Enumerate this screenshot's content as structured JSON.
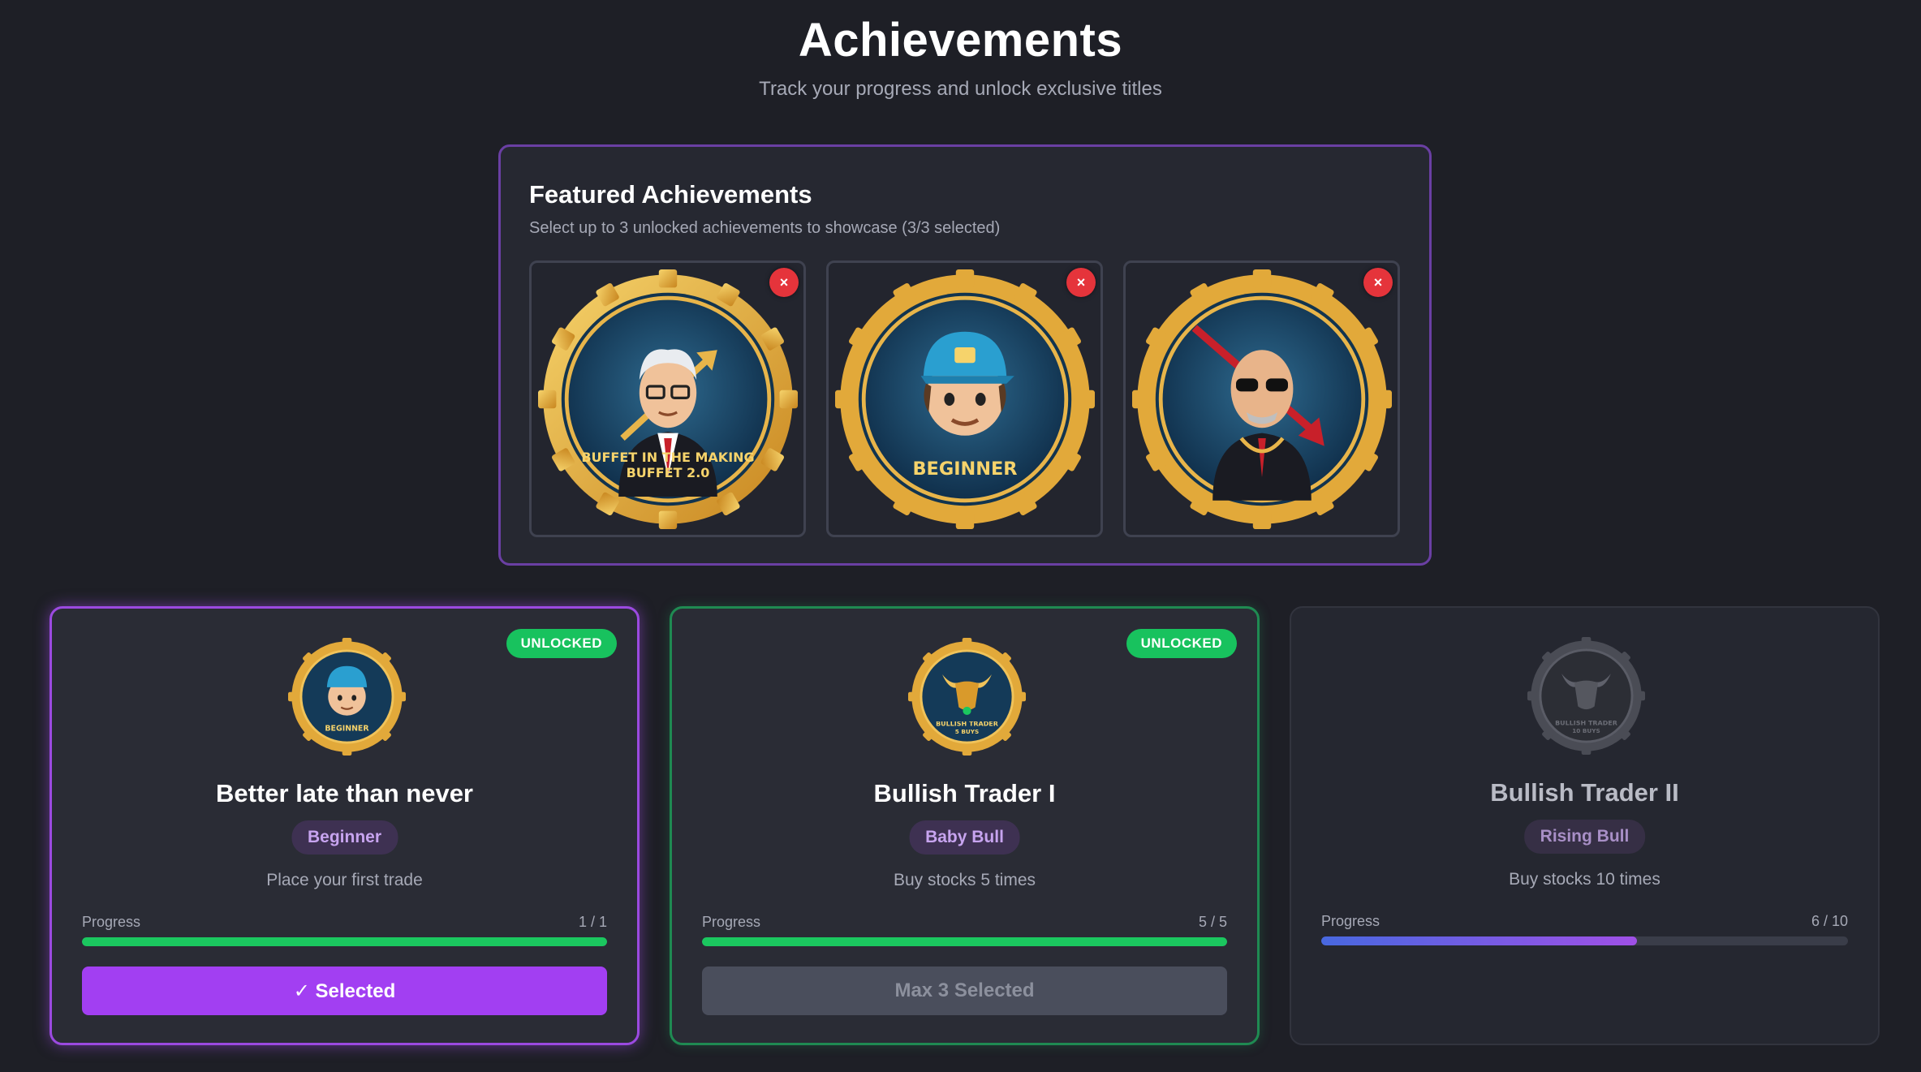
{
  "header": {
    "title": "Achievements",
    "subtitle": "Track your progress and unlock exclusive titles"
  },
  "featured": {
    "title": "Featured Achievements",
    "subtitle": "Select up to 3 unlocked achievements to showcase (3/3 selected)",
    "remove_label": "×",
    "slots": [
      {
        "medal_text_1": "BUFFET IN THE MAKING",
        "medal_text_2": "BUFFET 2.0",
        "icon": "old-investor-avatar"
      },
      {
        "medal_text_1": "BEGINNER",
        "medal_text_2": "",
        "icon": "beginner-cap-avatar"
      },
      {
        "medal_text_1": "",
        "medal_text_2": "",
        "icon": "bear-trader-avatar"
      }
    ]
  },
  "achievements": [
    {
      "status": "UNLOCKED",
      "medal_text_1": "BEGINNER",
      "medal_text_2": "",
      "name": "Better late than never",
      "title": "Beginner",
      "description": "Place your first trade",
      "progress_label": "Progress",
      "progress_text": "1 / 1",
      "progress": 1.0,
      "button": "✓ Selected"
    },
    {
      "status": "UNLOCKED",
      "medal_text_1": "BULLISH TRADER",
      "medal_text_2": "5 BUYS",
      "name": "Bullish Trader I",
      "title": "Baby Bull",
      "description": "Buy stocks 5 times",
      "progress_label": "Progress",
      "progress_text": "5 / 5",
      "progress": 1.0,
      "button": "Max 3 Selected"
    },
    {
      "status": "",
      "medal_text_1": "BULLISH TRADER",
      "medal_text_2": "10 BUYS",
      "name": "Bullish Trader II",
      "title": "Rising Bull",
      "description": "Buy stocks 10 times",
      "progress_label": "Progress",
      "progress_text": "6 / 10",
      "progress": 0.6,
      "button": ""
    }
  ],
  "colors": {
    "background": "#1e1f26",
    "accent_purple": "#a23ff2",
    "unlocked_green": "#18c25e",
    "remove_red": "#e5343b",
    "gold": "#e2a93a"
  }
}
